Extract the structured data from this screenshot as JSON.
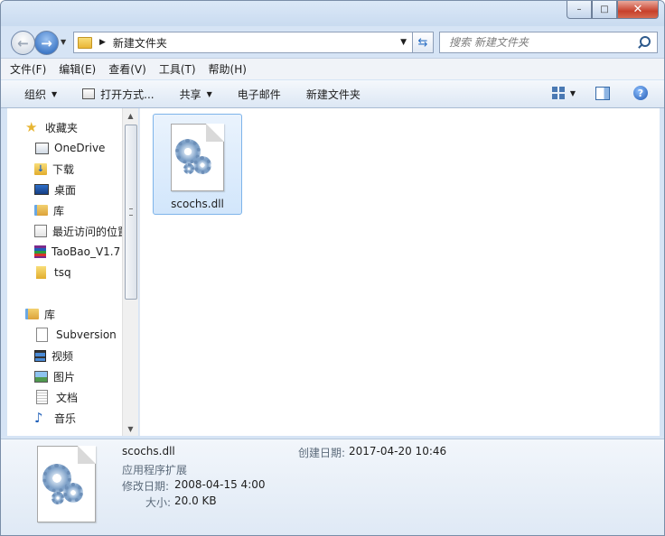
{
  "window": {
    "caption_min": "–",
    "caption_max": "□",
    "caption_close": "✕"
  },
  "address": {
    "back_icon": "←",
    "forward_icon": "→",
    "path": "新建文件夹",
    "search_placeholder": "搜索 新建文件夹"
  },
  "menu": [
    "文件(F)",
    "编辑(E)",
    "查看(V)",
    "工具(T)",
    "帮助(H)"
  ],
  "toolbar": {
    "organize": "组织",
    "open_with": "打开方式...",
    "share": "共享",
    "email": "电子邮件",
    "new_folder": "新建文件夹",
    "help": "?"
  },
  "nav": {
    "favorites": "收藏夹",
    "items": [
      "OneDrive",
      "下载",
      "桌面",
      "库",
      "最近访问的位置",
      "TaoBao_V1.7",
      "tsq"
    ],
    "libraries": "库",
    "lib_items": [
      "Subversion",
      "视频",
      "图片",
      "文档",
      "音乐"
    ]
  },
  "files": [
    {
      "name": "scochs.dll",
      "icon": "dll-gear-icon"
    }
  ],
  "details": {
    "name": "scochs.dll",
    "type": "应用程序扩展",
    "modified_label": "修改日期:",
    "modified_value": "2008-04-15 4:00",
    "size_label": "大小:",
    "size_value": "20.0 KB",
    "created_label": "创建日期:",
    "created_value": "2017-04-20 10:46"
  },
  "colors": {
    "selection": "#d2e6fb",
    "frame": "#d6e4f5",
    "accent": "#1f5fb8"
  }
}
